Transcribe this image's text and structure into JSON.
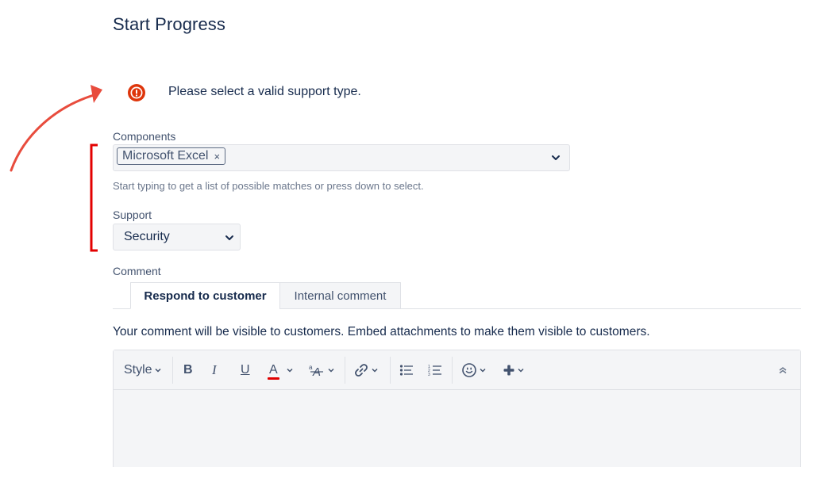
{
  "dialog": {
    "title": "Start Progress"
  },
  "error": {
    "icon": "error-icon",
    "message": "Please select a valid support type.",
    "color": "#de350b"
  },
  "components": {
    "label": "Components",
    "selected": [
      "Microsoft Excel"
    ],
    "remove_glyph": "×",
    "help_text": "Start typing to get a list of possible matches or press down to select."
  },
  "support": {
    "label": "Support",
    "value": "Security"
  },
  "comment": {
    "label": "Comment",
    "tabs": [
      {
        "label": "Respond to customer",
        "active": true
      },
      {
        "label": "Internal comment",
        "active": false
      }
    ],
    "visibility_note": "Your comment will be visible to customers. Embed attachments to make them visible to customers."
  },
  "toolbar": {
    "style_label": "Style",
    "bold": "B",
    "italic": "I",
    "underline": "U",
    "text_color": "A",
    "text_color_accent": "#e00000",
    "buttons": [
      "bold",
      "italic",
      "underline",
      "text-color",
      "more-formatting",
      "link",
      "bullet-list",
      "numbered-list",
      "emoji",
      "insert",
      "collapse"
    ]
  },
  "annotation": {
    "arrow_color": "#e84c3d",
    "bracket_color": "#e30000"
  }
}
